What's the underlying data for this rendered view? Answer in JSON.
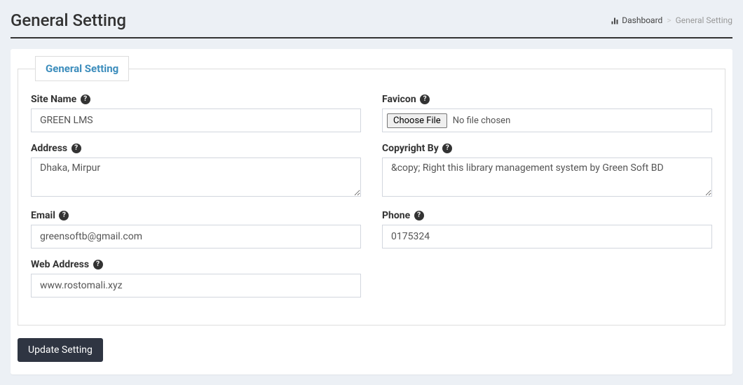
{
  "header": {
    "title": "General Setting"
  },
  "breadcrumb": {
    "dashboard": "Dashboard",
    "current": "General Setting",
    "sep": ">"
  },
  "legend": "General Setting",
  "labels": {
    "site_name": "Site Name",
    "address": "Address",
    "email": "Email",
    "web_address": "Web Address",
    "favicon": "Favicon",
    "copyright_by": "Copyright By",
    "phone": "Phone"
  },
  "values": {
    "site_name": "GREEN LMS",
    "address": "Dhaka, Mirpur",
    "email": "greensoftb@gmail.com",
    "web_address": "www.rostomali.xyz",
    "copyright_by": "&copy; Right this library management system by Green Soft BD",
    "phone": "0175324"
  },
  "file": {
    "choose": "Choose File",
    "none": "No file chosen"
  },
  "buttons": {
    "submit": "Update Setting"
  },
  "help_char": "?"
}
